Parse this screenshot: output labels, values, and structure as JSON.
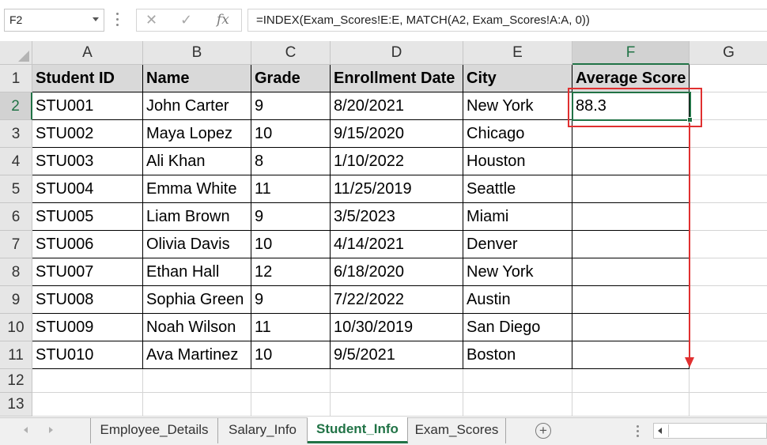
{
  "formula_bar": {
    "name_box": "F2",
    "cancel_icon": "✕",
    "enter_icon": "✓",
    "fx_label": "fx",
    "formula": "=INDEX(Exam_Scores!E:E, MATCH(A2, Exam_Scores!A:A, 0))"
  },
  "columns": [
    "A",
    "B",
    "C",
    "D",
    "E",
    "F",
    "G"
  ],
  "rows": [
    "1",
    "2",
    "3",
    "4",
    "5",
    "6",
    "7",
    "8",
    "9",
    "10",
    "11",
    "12",
    "13"
  ],
  "selected": {
    "column": "F",
    "row": "2"
  },
  "table": {
    "headers": [
      "Student ID",
      "Name",
      "Grade",
      "Enrollment Date",
      "City",
      "Average Score"
    ],
    "data": [
      [
        "STU001",
        "John Carter",
        "9",
        "8/20/2021",
        "New York",
        "88.3"
      ],
      [
        "STU002",
        "Maya Lopez",
        "10",
        "9/15/2020",
        "Chicago",
        ""
      ],
      [
        "STU003",
        "Ali Khan",
        "8",
        "1/10/2022",
        "Houston",
        ""
      ],
      [
        "STU004",
        "Emma White",
        "11",
        "11/25/2019",
        "Seattle",
        ""
      ],
      [
        "STU005",
        "Liam Brown",
        "9",
        "3/5/2023",
        "Miami",
        ""
      ],
      [
        "STU006",
        "Olivia Davis",
        "10",
        "4/14/2021",
        "Denver",
        ""
      ],
      [
        "STU007",
        "Ethan Hall",
        "12",
        "6/18/2020",
        "New York",
        ""
      ],
      [
        "STU008",
        "Sophia Green",
        "9",
        "7/22/2022",
        "Austin",
        ""
      ],
      [
        "STU009",
        "Noah Wilson",
        "11",
        "10/30/2019",
        "San Diego",
        ""
      ],
      [
        "STU010",
        "Ava Martinez",
        "10",
        "9/5/2021",
        "Boston",
        ""
      ]
    ]
  },
  "sheet_tabs": [
    {
      "label": "Employee_Details",
      "active": false
    },
    {
      "label": "Salary_Info",
      "active": false
    },
    {
      "label": "Student_Info",
      "active": true
    },
    {
      "label": "Exam_Scores",
      "active": false
    }
  ],
  "add_sheet_symbol": "+",
  "colors": {
    "accent": "#217346",
    "annotation": "#e03030",
    "header_fill": "#d9d9d9"
  }
}
